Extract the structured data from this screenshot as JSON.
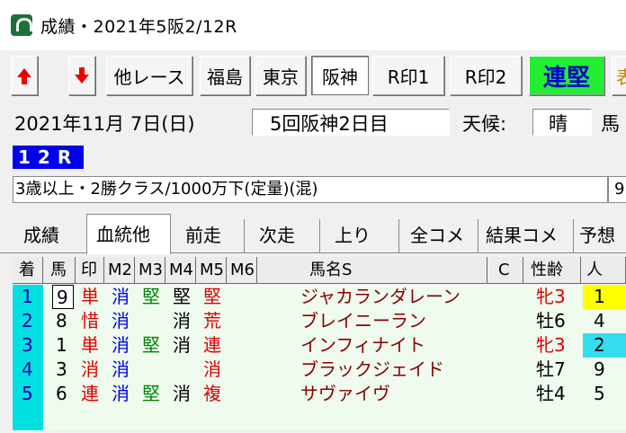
{
  "window": {
    "title": "成績・2021年5阪2/12R"
  },
  "toolbar": {
    "up_label": "",
    "down_label": "",
    "other_race": "他レース",
    "fukushima": "福島",
    "tokyo": "東京",
    "hanshin": "阪神",
    "r_mark1": "R印1",
    "r_mark2": "R印2",
    "renken": "連堅",
    "cut": "表"
  },
  "info": {
    "date": "2021年11月 7日(日)",
    "meeting": "5回阪神2日目",
    "weather_label": "天候:",
    "weather_value": "晴",
    "track_label": "馬"
  },
  "race": {
    "number": "12R",
    "class": "3歳以上・2勝クラス/1000万下(定量)(混)",
    "class_right": "9"
  },
  "tabs": [
    {
      "label": "成績"
    },
    {
      "label": "血統他"
    },
    {
      "label": "前走"
    },
    {
      "label": "次走"
    },
    {
      "label": "上り"
    },
    {
      "label": "全コメ"
    },
    {
      "label": "結果コメ"
    },
    {
      "label": "予想"
    }
  ],
  "table": {
    "headers": [
      "着",
      "馬",
      "印",
      "M2",
      "M3",
      "M4",
      "M5",
      "M6",
      "馬名S",
      "C",
      "性齢",
      "人"
    ],
    "rows": [
      {
        "rank": "1",
        "num": "9",
        "mark": "単",
        "m2": "消",
        "m3": "堅",
        "m4": "堅",
        "m5": "堅",
        "m6": "",
        "name": "ジャカランダレーン",
        "c": "",
        "sexage": "牝3",
        "pop": "1"
      },
      {
        "rank": "2",
        "num": "8",
        "mark": "惜",
        "m2": "消",
        "m3": "",
        "m4": "消",
        "m5": "荒",
        "m6": "",
        "name": "ブレイニーラン",
        "c": "",
        "sexage": "牡6",
        "pop": "4"
      },
      {
        "rank": "3",
        "num": "1",
        "mark": "単",
        "m2": "消",
        "m3": "堅",
        "m4": "消",
        "m5": "連",
        "m6": "",
        "name": "インフィナイト",
        "c": "",
        "sexage": "牝3",
        "pop": "2"
      },
      {
        "rank": "4",
        "num": "3",
        "mark": "消",
        "m2": "消",
        "m3": "",
        "m4": "",
        "m5": "消",
        "m6": "",
        "name": "ブラックジェイド",
        "c": "",
        "sexage": "牡7",
        "pop": "9"
      },
      {
        "rank": "5",
        "num": "6",
        "mark": "連",
        "m2": "消",
        "m3": "堅",
        "m4": "消",
        "m5": "複",
        "m6": "",
        "name": "サヴァイヴ",
        "c": "",
        "sexage": "牡4",
        "pop": "5"
      }
    ]
  },
  "colors": {
    "red_text": "#e00000",
    "blue_text": "#0000dd",
    "green_text": "#008800",
    "dark_red_name": "#880000",
    "rank_bg": "#00e0e0",
    "yellow_pop": "#ffff00",
    "cyan_pop": "#33ddee"
  }
}
